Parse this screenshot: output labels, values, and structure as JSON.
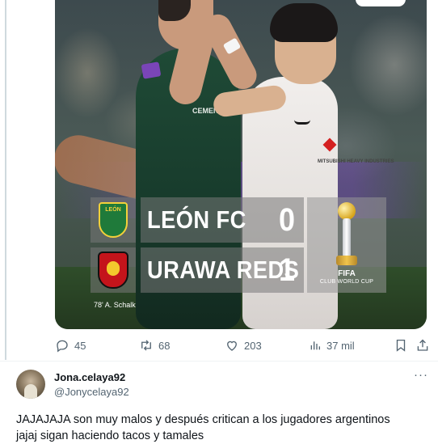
{
  "media": {
    "score_graphic": {
      "home": {
        "team": "LEÓN FC",
        "score": "0",
        "crest": "leon-crest"
      },
      "away": {
        "team": "URAWA REDS",
        "score": "1",
        "crest": "urawa-crest"
      },
      "goal_note": "78' A. Schalk",
      "tournament": {
        "wordmark": "FIFA",
        "subtitle": "CLUB WORLD CUP"
      }
    },
    "jersey_sponsors": {
      "left": "CEMENTOS FORTALEZA",
      "right": "MITSUBISHI HEAVY INDUSTRIES"
    },
    "colors": {
      "leon_green": "#1f4a36",
      "urawa_red": "#c4141b",
      "overlay_gray": "#787878",
      "purple_band": "#6e46aa"
    }
  },
  "actions": {
    "reply": {
      "icon": "reply-icon",
      "count": "45"
    },
    "repost": {
      "icon": "repost-icon",
      "count": "68"
    },
    "like": {
      "icon": "heart-icon",
      "count": "203"
    },
    "views": {
      "icon": "views-icon",
      "count": "37 mil"
    },
    "bookmark": {
      "icon": "bookmark-icon"
    },
    "share": {
      "icon": "share-icon"
    }
  },
  "reply": {
    "display_name": "Jona.celaya92",
    "handle": "@Jonycelaya92",
    "more_icon": "more-icon",
    "more_label": "···",
    "text_lines": [
      "JAJAJAJA son muy malos y después critican a los jugadores argentinos",
      "jajaj sigan haciendo tacos y tamales"
    ]
  },
  "theme": {
    "text_primary": "#0f1419",
    "text_secondary": "#536471",
    "divider": "#eff3f4"
  }
}
